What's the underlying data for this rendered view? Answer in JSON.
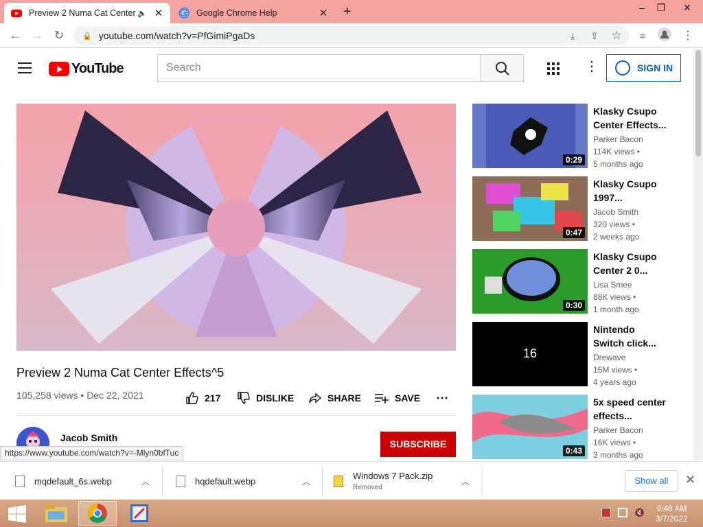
{
  "browser": {
    "tabs": [
      {
        "title": "Preview 2 Numa Cat Center Effects^5",
        "favicon": "youtube-icon",
        "active": true
      },
      {
        "title": "Google Chrome Help",
        "favicon": "google-icon",
        "active": false
      }
    ],
    "url": "youtube.com/watch?v=PfGimiPgaDs",
    "hover_url": "https://www.youtube.com/watch?v=-Mlyn0bfTuc"
  },
  "youtube": {
    "logo_text": "YouTube",
    "search_placeholder": "Search",
    "sign_in": "SIGN IN"
  },
  "video": {
    "title": "Preview 2 Numa Cat Center Effects^5",
    "views": "105,258 views",
    "date": "Dec 22, 2021",
    "likes": "217",
    "dislike": "DISLIKE",
    "share": "SHARE",
    "save": "SAVE",
    "channel": "Jacob Smith",
    "subscribe": "SUBSCRIBE"
  },
  "recommendations": [
    {
      "line1": "Klasky Csupo",
      "line2": "Center Effects...",
      "channel": "Parker Bacon",
      "views": "114K views •",
      "age": "5 months ago",
      "duration": "0:29"
    },
    {
      "line1": "Klasky Csupo",
      "line2": "1997...",
      "channel": "Jacob Smith",
      "views": "320 views •",
      "age": "2 weeks ago",
      "duration": "0:47"
    },
    {
      "line1": "Klasky Csupo",
      "line2": "Center 2 0...",
      "channel": "Lisa Smee",
      "views": "88K views •",
      "age": "1 month ago",
      "duration": "0:30"
    },
    {
      "line1": "Nintendo",
      "line2": "Switch click...",
      "channel": "Drewave",
      "views": "15M views •",
      "age": "4 years ago",
      "duration": "",
      "thumb_text": "16"
    },
    {
      "line1": "5x speed center",
      "line2": "effects...",
      "channel": "Parker Bacon",
      "views": "16K views •",
      "age": "3 months ago",
      "duration": "0:43"
    }
  ],
  "downloads": {
    "items": [
      {
        "name": "mqdefault_6s.webp",
        "status": ""
      },
      {
        "name": "hqdefault.webp",
        "status": ""
      },
      {
        "name": "Windows 7 Pack.zip",
        "status": "Removed"
      }
    ],
    "show_all": "Show all"
  },
  "taskbar": {
    "time": "9:48 AM",
    "date": "3/7/2022"
  },
  "colors": {
    "tab_strip": "#f5a39e",
    "youtube_red": "#ff0000",
    "subscribe_red": "#cc0000",
    "link_blue": "#065fd4",
    "taskbar": "#d0a07a"
  }
}
